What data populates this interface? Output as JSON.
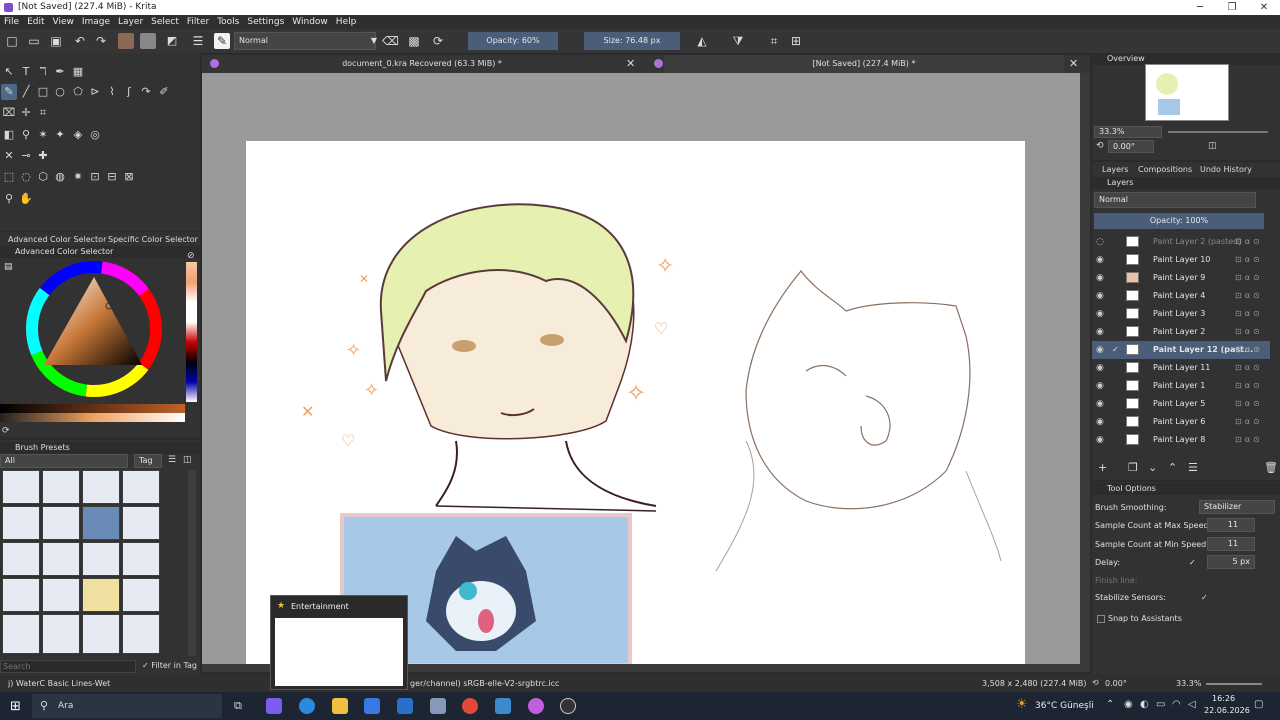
{
  "window": {
    "title": "[Not Saved] (227.4 MiB) - Krita",
    "min": "─",
    "restore": "❐",
    "close": "✕"
  },
  "menu": [
    "File",
    "Edit",
    "View",
    "Image",
    "Layer",
    "Select",
    "Filter",
    "Tools",
    "Settings",
    "Window",
    "Help"
  ],
  "toolbar": {
    "blend_mode": "Normal",
    "opacity": "Opacity: 60%",
    "size": "Size: 76.48 px"
  },
  "tabs": [
    {
      "label": "document_0.kra Recovered (63.3 MiB) *"
    },
    {
      "label": "[Not Saved] (227.4 MiB) *"
    }
  ],
  "docks": {
    "color_tabs": [
      "Advanced Color Selector",
      "Specific Color Selector"
    ],
    "color_title": "Advanced Color Selector",
    "brush_title": "Brush Presets",
    "brush_filter": "All",
    "brush_tag": "Tag",
    "search_placeholder": "Search",
    "filter_in_tag": "Filter in Tag"
  },
  "overview": {
    "title": "Overview",
    "zoom": "33.3%",
    "rotation": "0.00°"
  },
  "layers": {
    "tabs": [
      "Layers",
      "Compositions",
      "Undo History"
    ],
    "title": "Layers",
    "blend": "Normal",
    "opacity": "Opacity: 100%",
    "items": [
      {
        "name": "Paint Layer 2 (pasted)",
        "visible": false,
        "selected": false
      },
      {
        "name": "Paint Layer 10",
        "visible": true,
        "selected": false
      },
      {
        "name": "Paint Layer 9",
        "visible": true,
        "selected": false
      },
      {
        "name": "Paint Layer 4",
        "visible": true,
        "selected": false
      },
      {
        "name": "Paint Layer 3",
        "visible": true,
        "selected": false
      },
      {
        "name": "Paint Layer 2",
        "visible": true,
        "selected": false
      },
      {
        "name": "Paint Layer 12 (past...",
        "visible": true,
        "selected": true
      },
      {
        "name": "Paint Layer 11",
        "visible": true,
        "selected": false
      },
      {
        "name": "Paint Layer 1",
        "visible": true,
        "selected": false
      },
      {
        "name": "Paint Layer 5",
        "visible": true,
        "selected": false
      },
      {
        "name": "Paint Layer 6",
        "visible": true,
        "selected": false
      },
      {
        "name": "Paint Layer 8",
        "visible": true,
        "selected": false
      }
    ]
  },
  "tool_options": {
    "title": "Tool Options",
    "brush_smoothing_label": "Brush Smoothing:",
    "brush_smoothing_value": "Stabilizer",
    "max_speed_label": "Sample Count at Max Speed:",
    "max_speed_value": "11",
    "min_speed_label": "Sample Count at Min Speed:",
    "min_speed_value": "11",
    "delay_label": "Delay:",
    "delay_value": "5 px",
    "finish_line_label": "Finish line:",
    "stabilize_sensors_label": "Stabilize Sensors:",
    "snap_label": "Snap to Assistants"
  },
  "status": {
    "brush": "j) WaterC Basic Lines-Wet",
    "profile": "ger/channel)  sRGB-elle-V2-srgbtrc.icc",
    "dimensions": "3,508 x 2,480 (227.4 MiB)",
    "rotation": "0.00°",
    "zoom": "33.3%"
  },
  "popup": {
    "title": "Entertainment"
  },
  "taskbar": {
    "search": "Ara",
    "weather": "36°C  Güneşli",
    "time": "16:26",
    "date": "22.06.2026"
  }
}
